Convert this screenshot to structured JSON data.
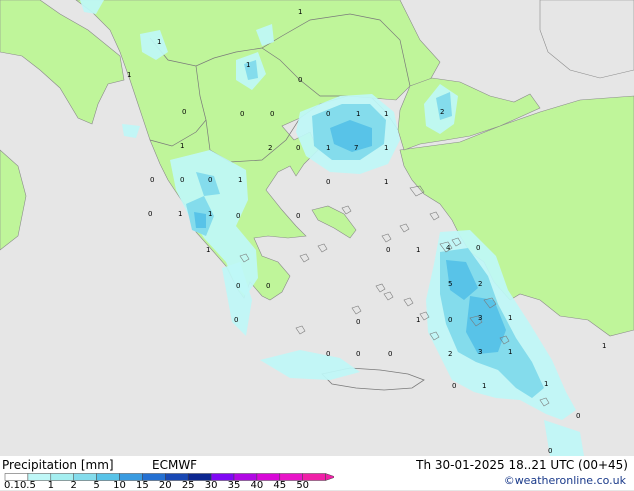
{
  "legend": {
    "title": "Precipitation [mm]",
    "model": "ECMWF",
    "classes": [
      {
        "label": "0.1",
        "color": "#ffffff"
      },
      {
        "label": "0.5",
        "color": "#bff7f7"
      },
      {
        "label": "1",
        "color": "#a4eef0"
      },
      {
        "label": "2",
        "color": "#84dcec"
      },
      {
        "label": "5",
        "color": "#58c3e8"
      },
      {
        "label": "10",
        "color": "#3a9be0"
      },
      {
        "label": "15",
        "color": "#2470d2"
      },
      {
        "label": "20",
        "color": "#1848b4"
      },
      {
        "label": "25",
        "color": "#0c2690"
      },
      {
        "label": "30",
        "color": "#7f08f4"
      },
      {
        "label": "35",
        "color": "#b008e4"
      },
      {
        "label": "40",
        "color": "#d808d8"
      },
      {
        "label": "45",
        "color": "#e814c8"
      },
      {
        "label": "50",
        "color": "#f020a8"
      }
    ]
  },
  "valid_time": "Th 30-01-2025 18..21 UTC (00+45)",
  "credit": "©weatheronline.co.uk",
  "colors": {
    "land": "#bff59a",
    "sea": "#e6e6e6",
    "border": "#7a7a7a",
    "coast": "#8a8a8a",
    "precip_light": "#bff7f7",
    "precip_mid": "#84dcec",
    "precip_heavy": "#58c3e8"
  },
  "map_values": [
    "1",
    "1",
    "1",
    "1",
    "0",
    "0",
    "0",
    "0",
    "0",
    "1",
    "1",
    "2",
    "2",
    "0",
    "1",
    "7",
    "1",
    "1",
    "0",
    "0",
    "0",
    "1",
    "0",
    "1",
    "0",
    "1",
    "1",
    "0",
    "0",
    "1",
    "0",
    "1",
    "4",
    "0",
    "5",
    "2",
    "0",
    "0",
    "1",
    "0",
    "3",
    "1",
    "0",
    "0",
    "0",
    "2",
    "3",
    "1",
    "0",
    "1",
    "0",
    "1",
    "0",
    "1",
    "0",
    "0"
  ]
}
